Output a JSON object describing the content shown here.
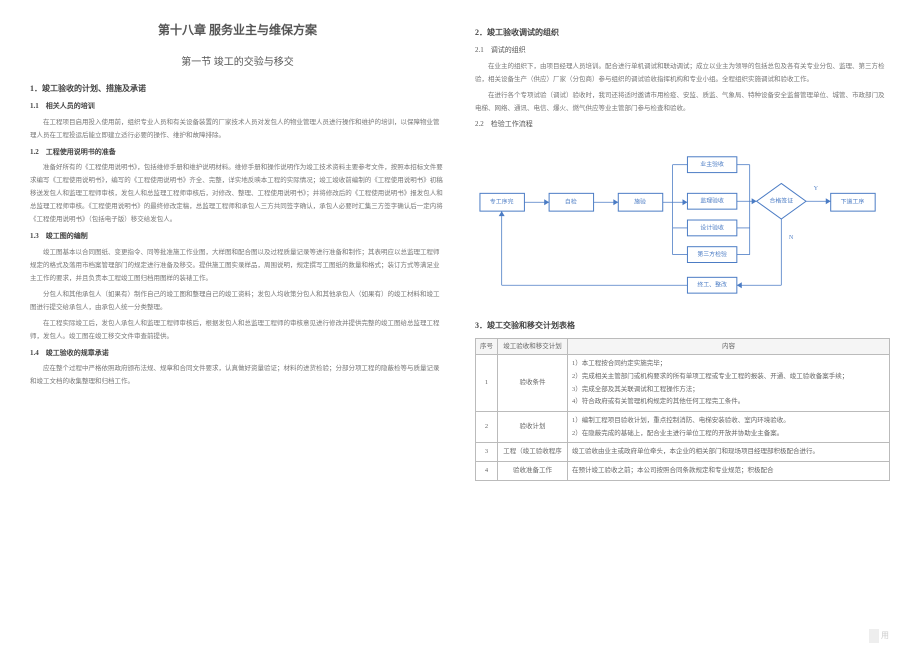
{
  "chapter": "第十八章 服务业主与维保方案",
  "section": "第一节 竣工的交验与移交",
  "s1": {
    "title": "1．竣工验收的计划、措施及承诺",
    "h11": "1.1　相关人员的培训",
    "p11": "在工程项目启用投入使用前，组织专业人员和有关设备装置的厂家技术人员对发包人的物业管理人员进行操作和维护的培训，以保障物业管理人员在工程投运后能立即建立适行必要的操作、维护和故障排除。",
    "h12": "1.2　工程使用说明书的准备",
    "p12a": "准备好所有的《工程使用说明书》，包括维修手册和维护说明材料。维修手册和操作说明作为竣工技术资料主要参考文件，按照本招标文件要求编写《工程使用说明书》，编写的《工程使用说明书》齐全、完整，详实地反映本工程的实际情况；竣工竣收前编制的《工程使用说明书》初稿移送发包人和监理工程师审核，发包人和总监理工程师审核后，对修改、整理、工程使用说明书》；并将修改后的《工程使用说明书》报发包人和总监理工程师审核。《工程使用说明书》的最终修改定稿，总监理工程师和承包人三方共同签字确认，承包人必要时汇集三方签字确认后一定内将《工程使用说明书》（包括电子版）移交给发包人。",
    "h13": "1.3　竣工图的编制",
    "p13a": "竣工图基本以合同图纸、变更指令、同等批准施工作业图，大样图和配合图以及过程质量记录等进行准备和制作；其表明应以总监理工程师规定的格式及落用市档案管理部门的规定进行准备及移交。提供施工图实录样品，周围说明，规定撰写工图纸的数量和格式；装订方式等满足业主工作的要求，并且负责本工程竣工图归档用图样的装裱工作。",
    "p13b": "分包人和其他承包人（如果有）制作自己的竣工图和整理自己的竣工资料；发包人均收策分包人和其他承包人（如果有）的竣工材料和竣工图进行提交给承包人，由承包人统一分类整理。",
    "p13c": "在工程实际竣工后，发包人承包人和监理工程师审核后，根据发包人和总监理工程师的审核意见进行修改并提供完整的竣工图给总监理工程师，发包人。竣工图在竣工移交文件审查前提供。",
    "h14": "1.4　竣工验收的规章承诺",
    "p14": "应在整个过程中严格依照政府颁布法规、规章和合同文件要求，认真做好资量验证；材料的进货检验；分部分项工程的隐蔽检等与质量记录和竣工文档的收集整理和归档工作。"
  },
  "s2": {
    "title": "2．竣工验收调试的组织",
    "h21": "2.1　调试的组织",
    "p21a": "在业主的组织下，由项目经理人员培训。配合进行单机调试和联动调试；成立以业主为领导的包括总包及各有关专业分包、监理、第三方检验，相关设备生产（供应）厂家（分包商）参与组织的调试验收指挥机构和专业小组。全程组织实施调试和验收工作。",
    "p21b": "在进行各个专项试验（调试）验收时，我司还将适时邀请市用检疫、安监、质监、气象局、特种设备安全监督管理单位、城管、市政部门及电梯、网络、通讯、电信、爆火、燃气供应等业主管部门参与检查和验收。",
    "h22": "2.2　检验工作流程"
  },
  "flow": {
    "b1": "专工序完",
    "b2": "自检",
    "b3": "施验",
    "b4": "业主验收",
    "b5": "监理验收",
    "b6": "设计验收",
    "b7": "第三方检验",
    "b8": "终工、整改",
    "b9": "合格签证",
    "b10": "下道工序",
    "b11": "Y",
    "b12": "N"
  },
  "s3": {
    "title": "3．竣工交验和移交计划表格",
    "th1": "序号",
    "th2": "竣工验收和移交计划",
    "th3": "内容",
    "rows": [
      {
        "num": "1",
        "name": "验收条件",
        "items": [
          "1）本工程按合同约定实施完毕；",
          "2）完成相关主管部门或机构要求的所有单项工程或专业工程的报装、开通、竣工验收备案手续；",
          "3）完成全部及其关联调试和工程操作方法；",
          "4）符合政府或有关管理机构规定的其他任何工程完工条件。"
        ]
      },
      {
        "num": "2",
        "name": "验收计划",
        "items": [
          "1）编制工程项目验收计划，重点控制消防、电梯安装验收、室内环境验收。",
          "2）在隐蔽完成的基础上，配合业主进行单位工程的开放并协助业主备案。"
        ]
      },
      {
        "num": "3",
        "name": "工程（竣工验收程序",
        "items": [
          "竣工验收由业主或政府单位牵头，本企业的相关部门和现场项目经理部积极配合进行。"
        ]
      },
      {
        "num": "4",
        "name": "验收准备工作",
        "items": [
          "在预计竣工验收之前；本公司按照合同条款规定和专业规范；积极配合"
        ]
      }
    ]
  },
  "footer": "用"
}
